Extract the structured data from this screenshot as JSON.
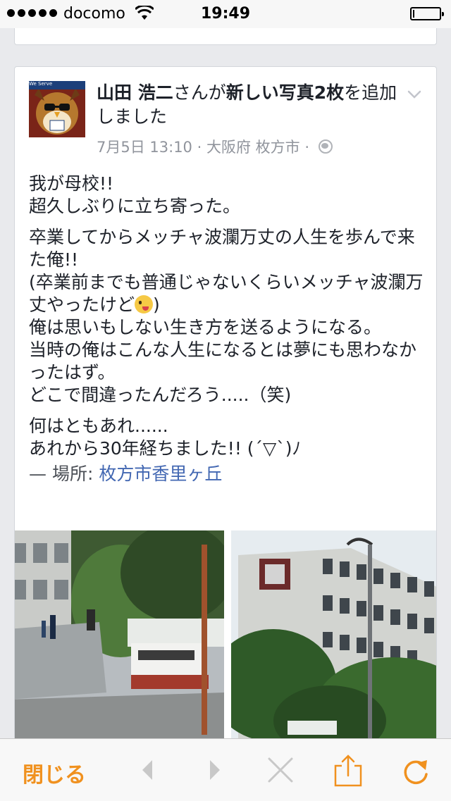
{
  "status_bar": {
    "carrier": "docomo",
    "time": "19:49",
    "battery_level": 0.05
  },
  "post": {
    "author": "山田 浩二",
    "action_pre": "さんが",
    "action_strong": "新しい写真2枚",
    "action_post": "を追加しました",
    "date": "7月5日 13:10",
    "location_meta": "大阪府 枚方市",
    "avatar_badge": "We Serve",
    "lines": [
      [
        "我が母校!!",
        "超久しぶりに立ち寄った。"
      ],
      [
        "卒業してからメッチャ波瀾万丈の人生を歩んで来た俺!!",
        "(卒業前までも普通じゃないくらいメッチャ波瀾万丈やったけど"
      ],
      [
        "俺は思いもしない生き方を送るようになる。",
        "当時の俺はこんな人生になるとは夢にも思わなかったはず。",
        "どこで間違ったんだろう.....（笑)"
      ],
      [
        "何はともあれ......",
        "あれから30年経ちました!! (´▽`)ﾉ"
      ]
    ],
    "p2_close": ")",
    "place_prefix": "— 場所: ",
    "place_name": "枚方市香里ヶ丘"
  },
  "toolbar": {
    "close_label": "閉じる"
  },
  "colors": {
    "accent": "#f0911f",
    "link": "#4267b2",
    "meta": "#90949c"
  },
  "icons": [
    "wifi-icon",
    "chevron-down-icon",
    "globe-icon",
    "back-icon",
    "forward-icon",
    "stop-icon",
    "share-icon",
    "reload-icon"
  ]
}
